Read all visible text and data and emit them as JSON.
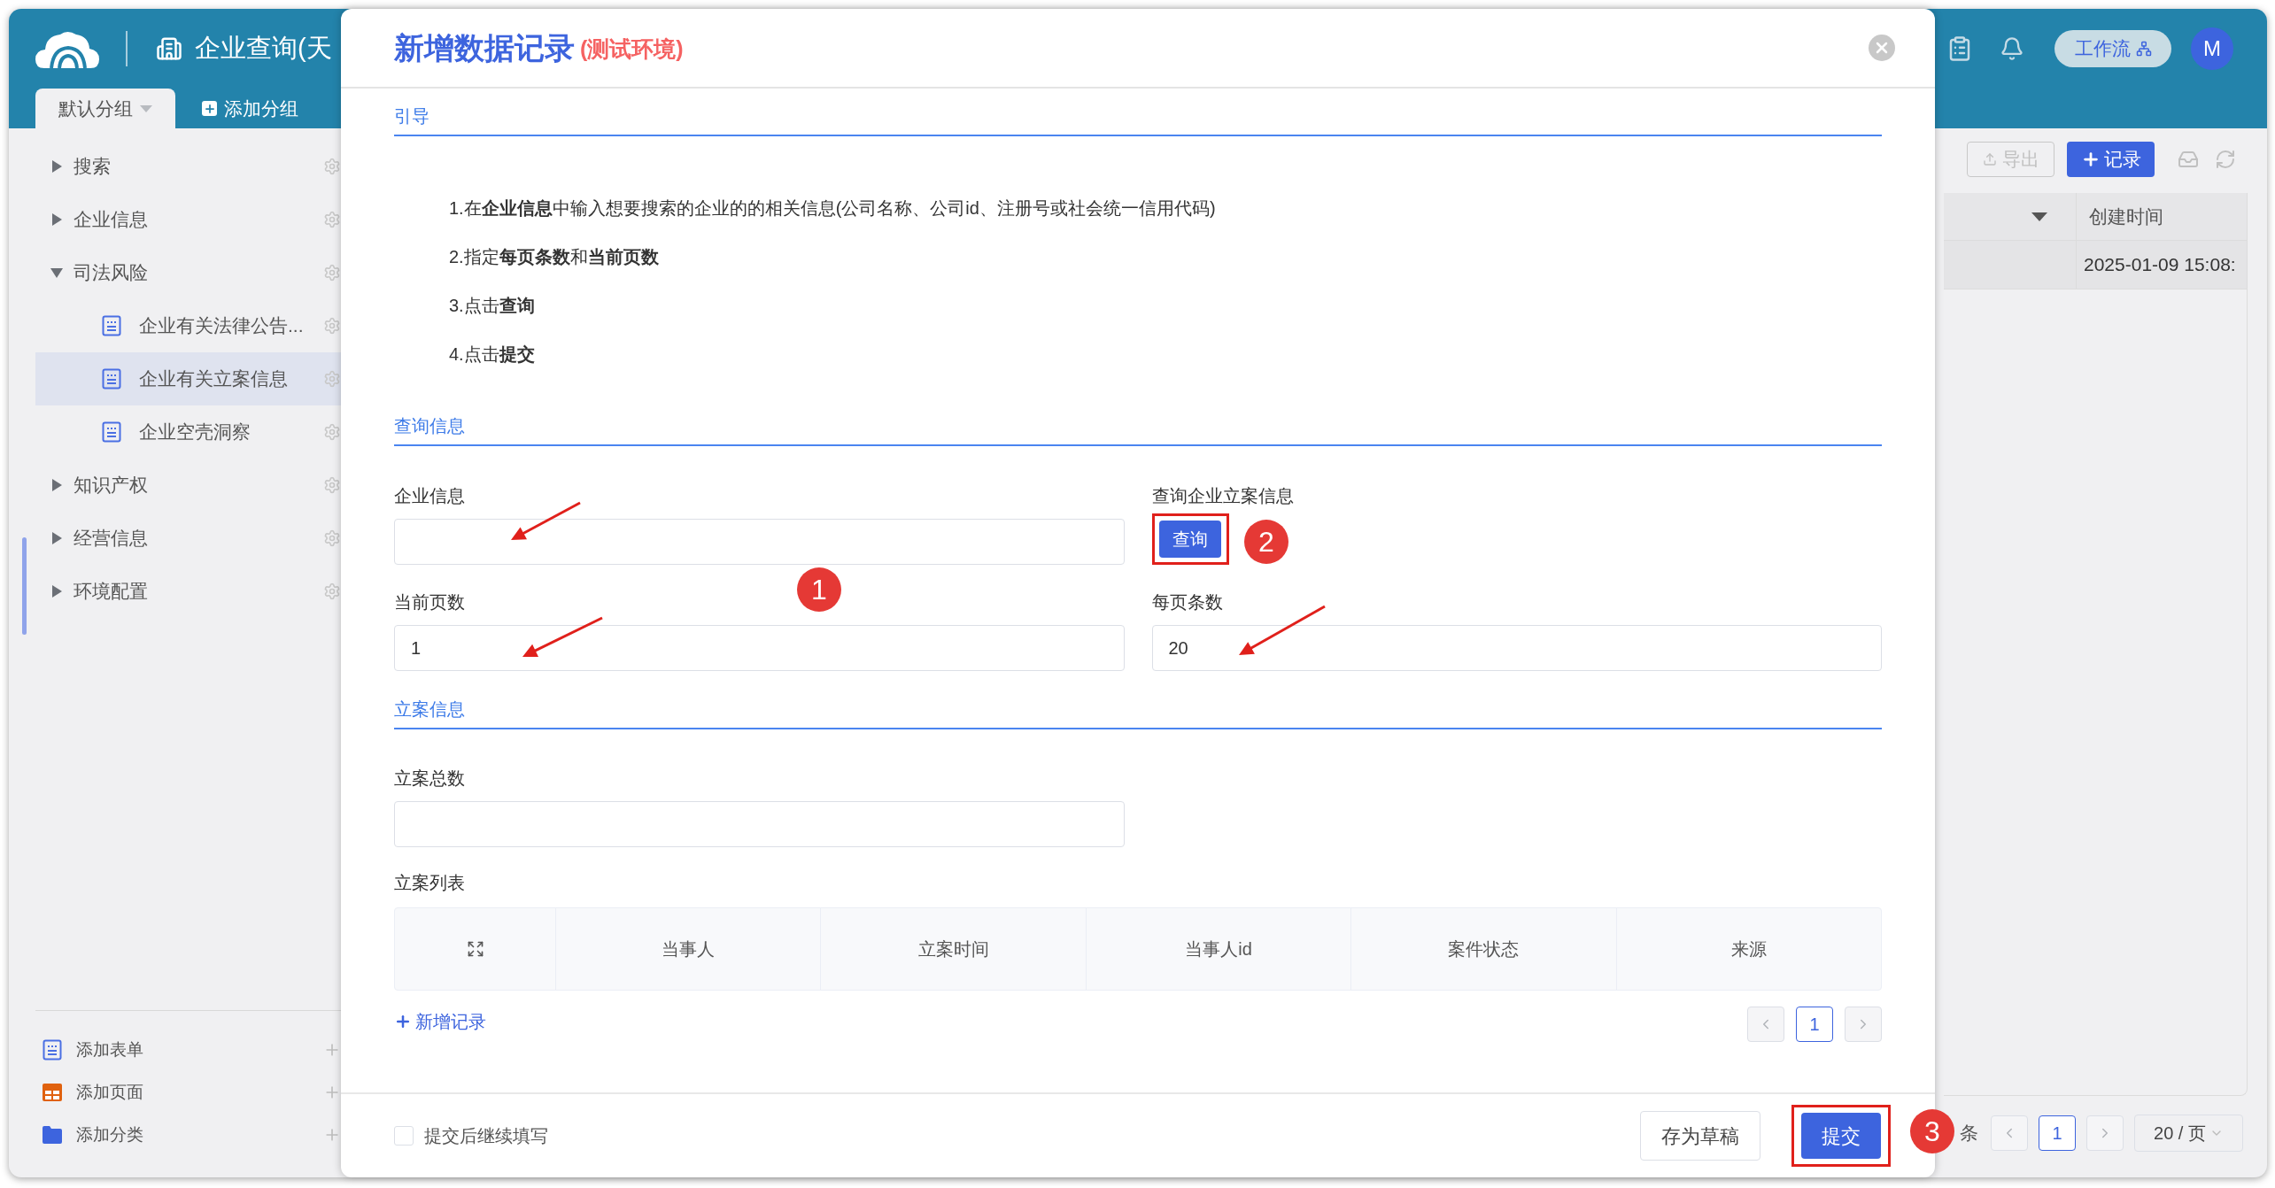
{
  "app": {
    "title": "企业查询(天",
    "group_tabs": [
      {
        "label": "默认分组",
        "selected": true
      }
    ],
    "add_group": "添加分组",
    "workflow_button": "工作流",
    "avatar": "M"
  },
  "sidebar": {
    "items": [
      {
        "label": "搜索",
        "expanded": false,
        "selected": false
      },
      {
        "label": "企业信息",
        "expanded": false,
        "selected": false
      },
      {
        "label": "司法风险",
        "expanded": true,
        "selected": false,
        "children": [
          {
            "label": "企业有关法律公告...",
            "selected": false
          },
          {
            "label": "企业有关立案信息",
            "selected": true
          },
          {
            "label": "企业空壳洞察",
            "selected": false
          }
        ]
      },
      {
        "label": "知识产权",
        "expanded": false,
        "selected": false
      },
      {
        "label": "经营信息",
        "expanded": false,
        "selected": false
      },
      {
        "label": "环境配置",
        "expanded": false,
        "selected": false
      }
    ],
    "actions": [
      {
        "kind": "form",
        "label": "添加表单"
      },
      {
        "kind": "page",
        "label": "添加页面"
      },
      {
        "kind": "category",
        "label": "添加分类"
      }
    ]
  },
  "toolbar": {
    "export": "导出",
    "add_record": "记录"
  },
  "table": {
    "columns": [
      "创建时间"
    ],
    "rows": [
      [
        "2025-01-09 15:08:"
      ]
    ]
  },
  "pagination": {
    "summary": "条",
    "pages": [
      {
        "label": "1",
        "selected": true
      }
    ],
    "page_size": "20 / 页"
  },
  "dialog": {
    "title": "新增数据记录",
    "env_tag": "(测试环境)",
    "guide": {
      "heading": "引导",
      "steps": [
        "1.在**企业信息**中输入想要搜索的企业的的相关信息(公司名称、公司id、注册号或社会统一信用代码)",
        "2.指定**每页条数**和**当前页数**",
        "3.点击**查询**",
        "4.点击**提交**"
      ]
    },
    "query": {
      "heading": "查询信息",
      "company_field": {
        "label": "企业信息"
      },
      "query_action": {
        "label": "查询企业立案信息",
        "button": "查询"
      },
      "page_field": {
        "label": "当前页数",
        "value": "1"
      },
      "size_field": {
        "label": "每页条数",
        "value": "20"
      }
    },
    "filing": {
      "heading": "立案信息",
      "total_field": {
        "label": "立案总数"
      },
      "list_label": "立案列表",
      "columns": [
        "当事人",
        "立案时间",
        "当事人id",
        "案件状态",
        "来源"
      ],
      "add_record": "新增记录",
      "pages": [
        {
          "label": "1",
          "selected": true
        }
      ]
    },
    "footer": {
      "continue_checkbox": {
        "label": "提交后继续填写",
        "checked": false
      },
      "draft_button": "存为草稿",
      "submit_button": "提交"
    }
  },
  "annotations": [
    "1",
    "2",
    "3"
  ]
}
